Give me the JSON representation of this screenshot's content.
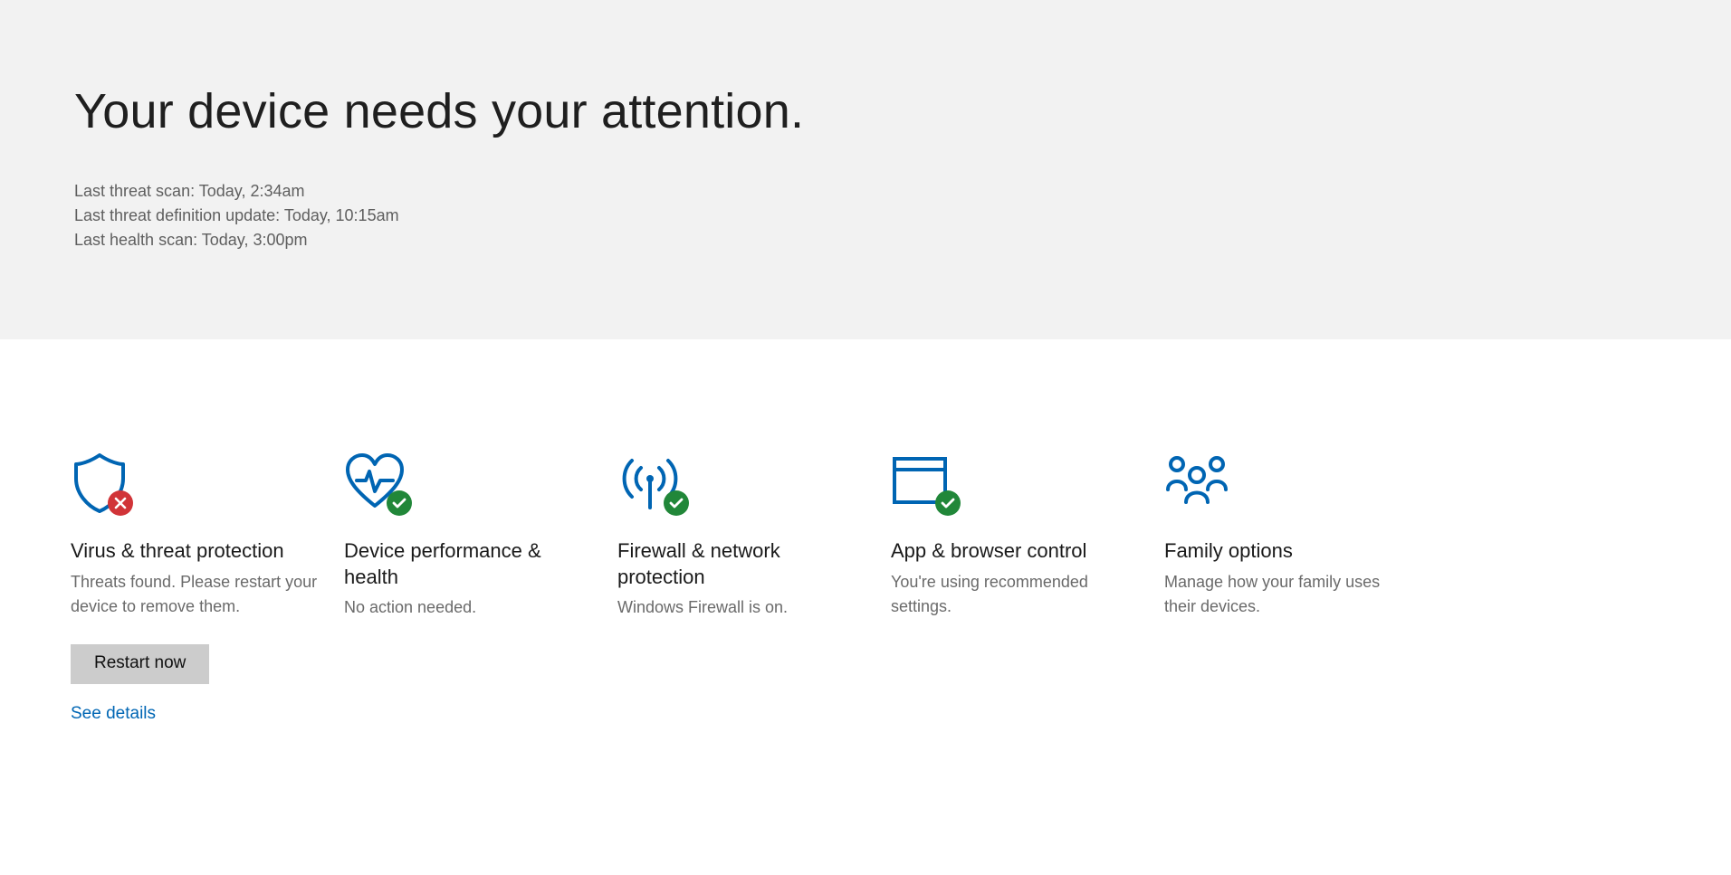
{
  "hero": {
    "title": "Your device needs your attention.",
    "status_scan": "Last threat scan: Today, 2:34am",
    "status_defs": "Last threat definition update: Today, 10:15am",
    "status_health": "Last health scan: Today, 3:00pm"
  },
  "cards": {
    "virus": {
      "title": "Virus & threat protection",
      "sub": "Threats found. Please restart your device to remove them.",
      "action": "Restart now",
      "details": "See details"
    },
    "device": {
      "title": "Device performance & health",
      "sub": "No action needed."
    },
    "firewall": {
      "title": "Firewall & network protection",
      "sub": "Windows Firewall is on."
    },
    "app": {
      "title": "App & browser control",
      "sub": "You're using recommended settings."
    },
    "family": {
      "title": "Family options",
      "sub": "Manage how your family uses their devices."
    }
  },
  "colors": {
    "accent": "#0065b3",
    "error": "#d13438",
    "ok": "#218739"
  }
}
